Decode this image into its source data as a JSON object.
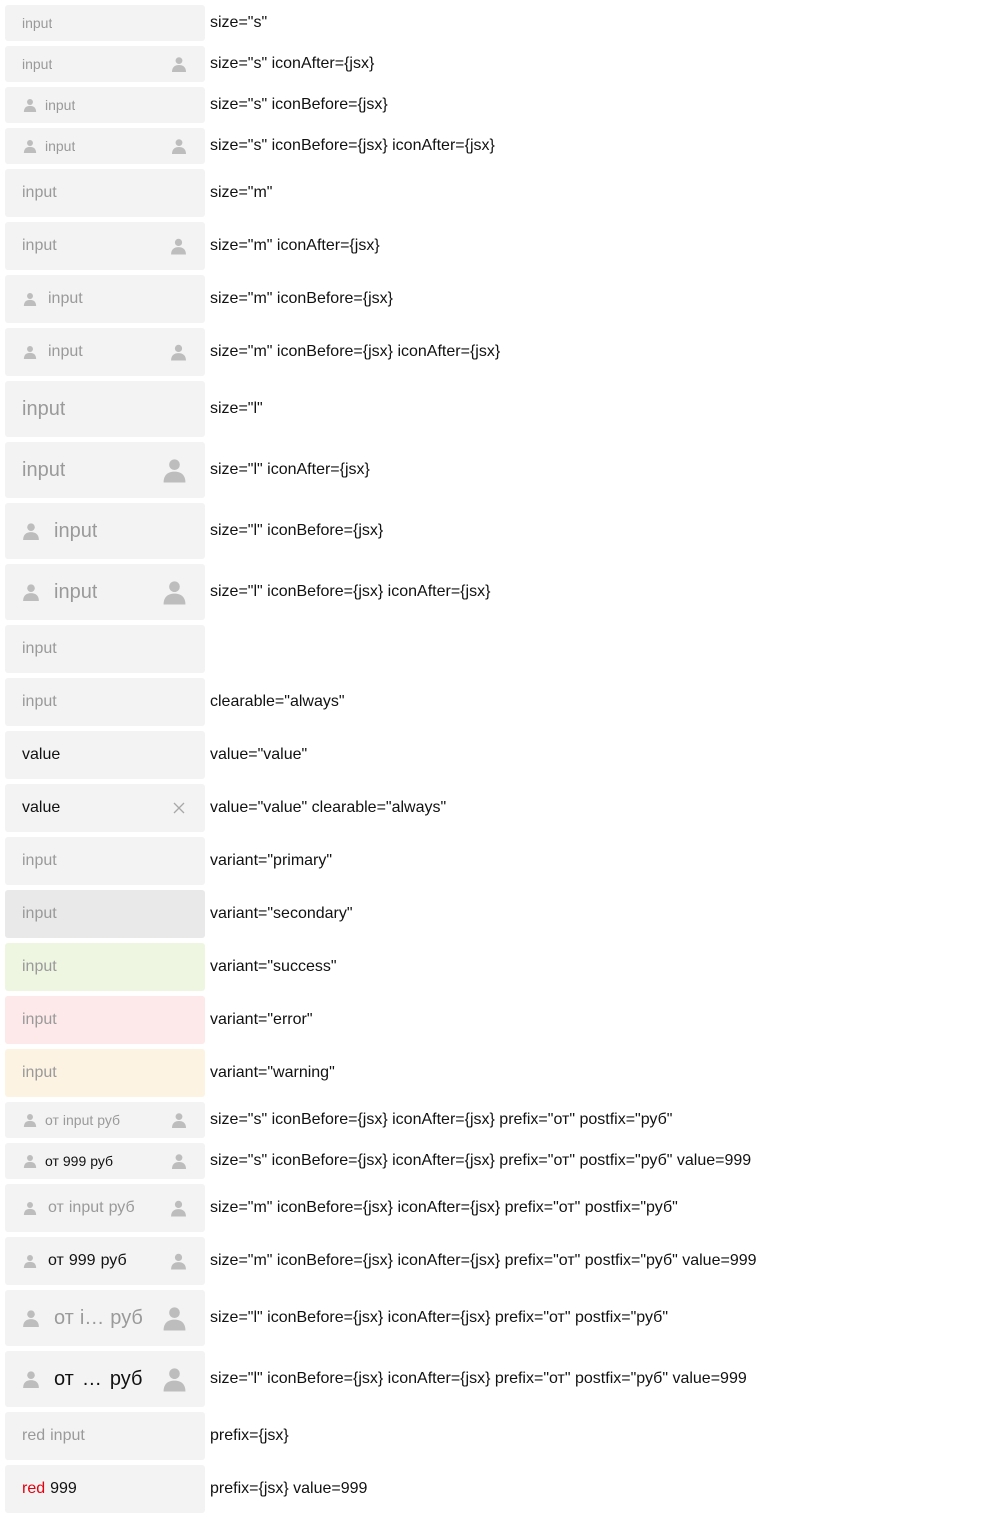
{
  "placeholder": "input",
  "value_text": "value",
  "prefix": "от",
  "postfix": "руб",
  "num_value": "999",
  "ellipsis": "…",
  "truncated_input": "i…",
  "red_prefix": "red",
  "icons": {
    "user": "user-icon",
    "clear": "close-icon"
  },
  "colors": {
    "field_bg": "#f3f3f3",
    "secondary_bg": "#e9e9e9",
    "success_bg": "#eef6e2",
    "error_bg": "#fde9e9",
    "warning_bg": "#fdf3e3",
    "placeholder": "#9a9a9a",
    "red_prefix": "#e3000f"
  },
  "rows": [
    {
      "caption": "size=\"s\""
    },
    {
      "caption": "size=\"s\" iconAfter={jsx}"
    },
    {
      "caption": "size=\"s\" iconBefore={jsx}"
    },
    {
      "caption": "size=\"s\" iconBefore={jsx} iconAfter={jsx}"
    },
    {
      "caption": "size=\"m\""
    },
    {
      "caption": "size=\"m\" iconAfter={jsx}"
    },
    {
      "caption": "size=\"m\" iconBefore={jsx}"
    },
    {
      "caption": "size=\"m\" iconBefore={jsx} iconAfter={jsx}"
    },
    {
      "caption": "size=\"l\""
    },
    {
      "caption": "size=\"l\" iconAfter={jsx}"
    },
    {
      "caption": "size=\"l\" iconBefore={jsx}"
    },
    {
      "caption": "size=\"l\" iconBefore={jsx} iconAfter={jsx}"
    },
    {
      "caption": ""
    },
    {
      "caption": "clearable=\"always\""
    },
    {
      "caption": "value=\"value\""
    },
    {
      "caption": "value=\"value\" clearable=\"always\""
    },
    {
      "caption": "variant=\"primary\""
    },
    {
      "caption": "variant=\"secondary\""
    },
    {
      "caption": "variant=\"success\""
    },
    {
      "caption": "variant=\"error\""
    },
    {
      "caption": "variant=\"warning\""
    },
    {
      "caption": "size=\"s\" iconBefore={jsx} iconAfter={jsx} prefix=\"от\" postfix=\"руб\""
    },
    {
      "caption": "size=\"s\" iconBefore={jsx} iconAfter={jsx} prefix=\"от\" postfix=\"руб\" value=999"
    },
    {
      "caption": "size=\"m\" iconBefore={jsx} iconAfter={jsx} prefix=\"от\" postfix=\"руб\""
    },
    {
      "caption": "size=\"m\" iconBefore={jsx} iconAfter={jsx} prefix=\"от\" postfix=\"руб\" value=999"
    },
    {
      "caption": "size=\"l\" iconBefore={jsx} iconAfter={jsx} prefix=\"от\" postfix=\"руб\""
    },
    {
      "caption": "size=\"l\" iconBefore={jsx} iconAfter={jsx} prefix=\"от\" postfix=\"руб\" value=999"
    },
    {
      "caption": "prefix={jsx}"
    },
    {
      "caption": "prefix={jsx} value=999"
    }
  ]
}
